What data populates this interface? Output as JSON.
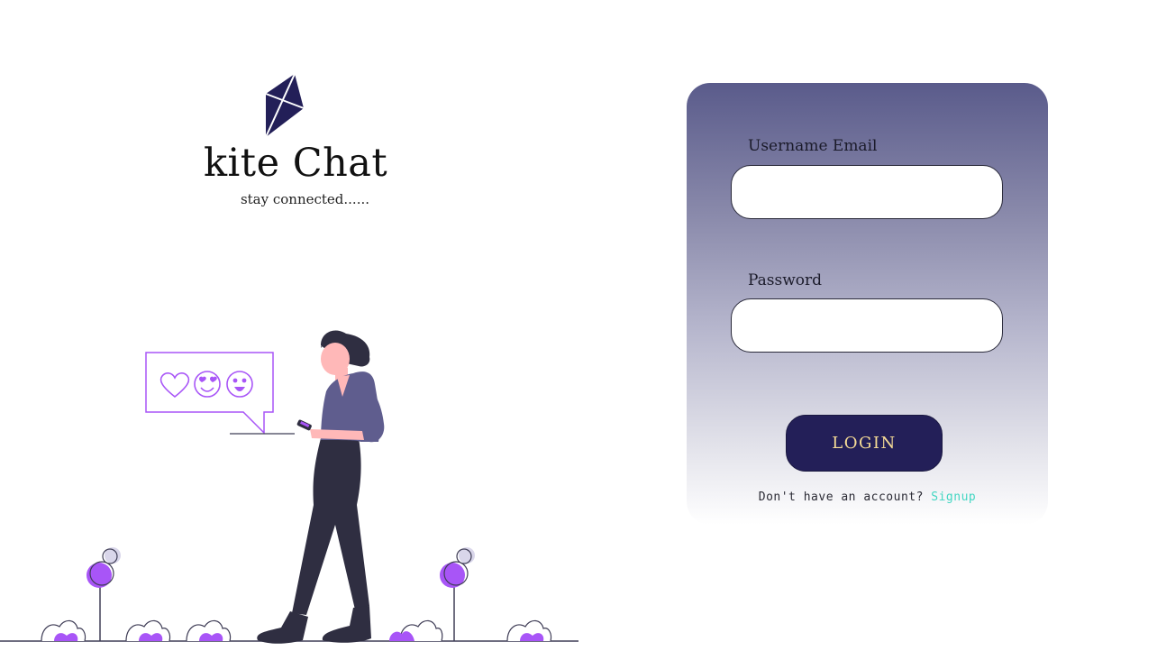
{
  "brand": {
    "title": "kite Chat",
    "tagline": "stay connected......",
    "logo_icon": "kite-icon",
    "logo_color": "#231f58"
  },
  "illustration": {
    "description_icon": "woman-texting-illustration",
    "accent_color": "#a855f7",
    "bubble_icons": [
      "heart-icon",
      "heart-eyes-emoji-icon",
      "smiling-emoji-icon"
    ]
  },
  "login": {
    "username_label": "Username   Email",
    "password_label": "Password",
    "username_value": "",
    "password_value": "",
    "button_label": "LOGIN",
    "signup_prompt": "Don't have an account?",
    "signup_link": "Signup",
    "colors": {
      "card_top": "#5a5b8b",
      "button_bg": "#231f58",
      "button_text": "#f6dc96",
      "link": "#42d6c2"
    }
  }
}
